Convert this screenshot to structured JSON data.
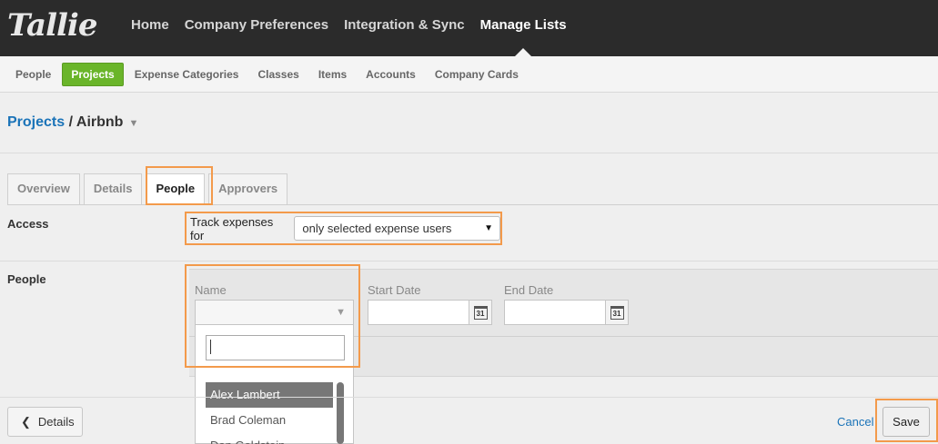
{
  "brand": {
    "logo_text": "Tallie"
  },
  "topnav": [
    {
      "label": "Home"
    },
    {
      "label": "Company Preferences"
    },
    {
      "label": "Integration & Sync"
    },
    {
      "label": "Manage Lists",
      "active": true
    }
  ],
  "subnav": [
    {
      "label": "People"
    },
    {
      "label": "Projects",
      "active": true
    },
    {
      "label": "Expense Categories"
    },
    {
      "label": "Classes"
    },
    {
      "label": "Items"
    },
    {
      "label": "Accounts"
    },
    {
      "label": "Company Cards"
    }
  ],
  "breadcrumb": {
    "parent": "Projects",
    "separator": " / ",
    "current": "Airbnb"
  },
  "tabs": [
    {
      "label": "Overview"
    },
    {
      "label": "Details"
    },
    {
      "label": "People",
      "active": true
    },
    {
      "label": "Approvers"
    }
  ],
  "access": {
    "label": "Access",
    "prefix": "Track expenses for",
    "selected": "only selected expense users"
  },
  "people": {
    "label": "People",
    "name_label": "Name",
    "start_date_label": "Start Date",
    "end_date_label": "End Date",
    "calendar_day": "31",
    "search_value": "",
    "options": [
      "Alex Lambert",
      "Brad Coleman",
      "Dan Goldstein"
    ]
  },
  "footer": {
    "back_label": "Details",
    "cancel_label": "Cancel",
    "save_label": "Save"
  },
  "colors": {
    "accent_green": "#6ab52a",
    "link_blue": "#1a73b8",
    "highlight_orange": "#f39a4b",
    "topbar": "#2b2b2b"
  }
}
